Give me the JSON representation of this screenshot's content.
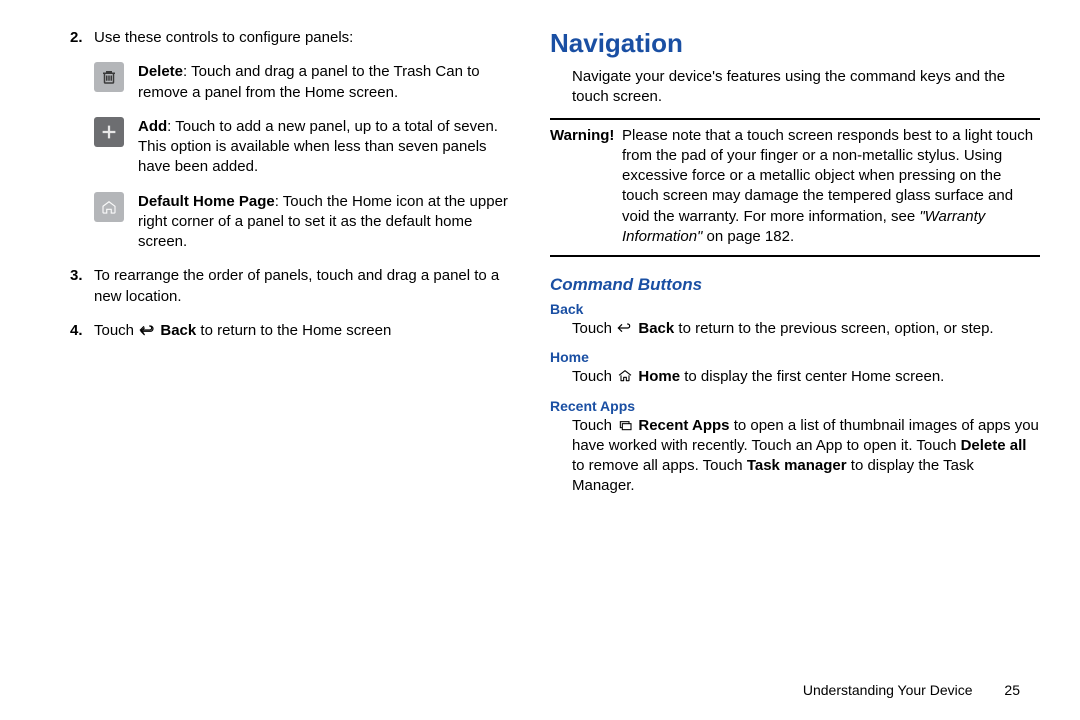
{
  "left": {
    "step2": {
      "num": "2.",
      "text": "Use these controls to configure panels:"
    },
    "delete": {
      "label": "Delete",
      "text": ": Touch and drag a panel to the Trash Can to remove a panel from the Home screen."
    },
    "add": {
      "label": "Add",
      "text": ": Touch to add a new panel, up to a total of seven. This option is available when less than seven panels have been added."
    },
    "default": {
      "label": "Default Home Page",
      "text": ": Touch the Home icon at the upper right corner of a panel to set it as the default home screen."
    },
    "step3": {
      "num": "3.",
      "text": "To rearrange the order of panels, touch and drag a panel to a new location."
    },
    "step4": {
      "num": "4.",
      "pre": "Touch ",
      "back_label": "Back",
      "post": " to return to the Home screen"
    }
  },
  "right": {
    "h1": "Navigation",
    "intro": "Navigate your device's features using the command keys and the touch screen.",
    "warning_label": "Warning!",
    "warning_body_1": "Please note that a touch screen responds best to a light touch from the pad of your finger or a non-metallic stylus. Using excessive force or a metallic object when pressing on the touch screen may damage the tempered glass surface and void the warranty. For more information, see ",
    "warning_ref": "\"Warranty Information\"",
    "warning_body_2": " on page 182.",
    "h2": "Command Buttons",
    "back": {
      "h3": "Back",
      "pre": "Touch ",
      "label": "Back",
      "post": " to return to the previous screen, option, or step."
    },
    "home": {
      "h3": "Home",
      "pre": "Touch ",
      "label": "Home",
      "post": " to display the first center Home screen."
    },
    "recent": {
      "h3": "Recent Apps",
      "pre": "Touch ",
      "label": "Recent Apps",
      "mid1": " to open a list of thumbnail images of apps you have worked with recently. Touch an App to open it. Touch ",
      "del_all": "Delete all",
      "mid2": " to remove all apps. Touch ",
      "task_mgr": "Task manager",
      "post": " to display the Task Manager."
    }
  },
  "footer": {
    "section": "Understanding Your Device",
    "page": "25"
  }
}
